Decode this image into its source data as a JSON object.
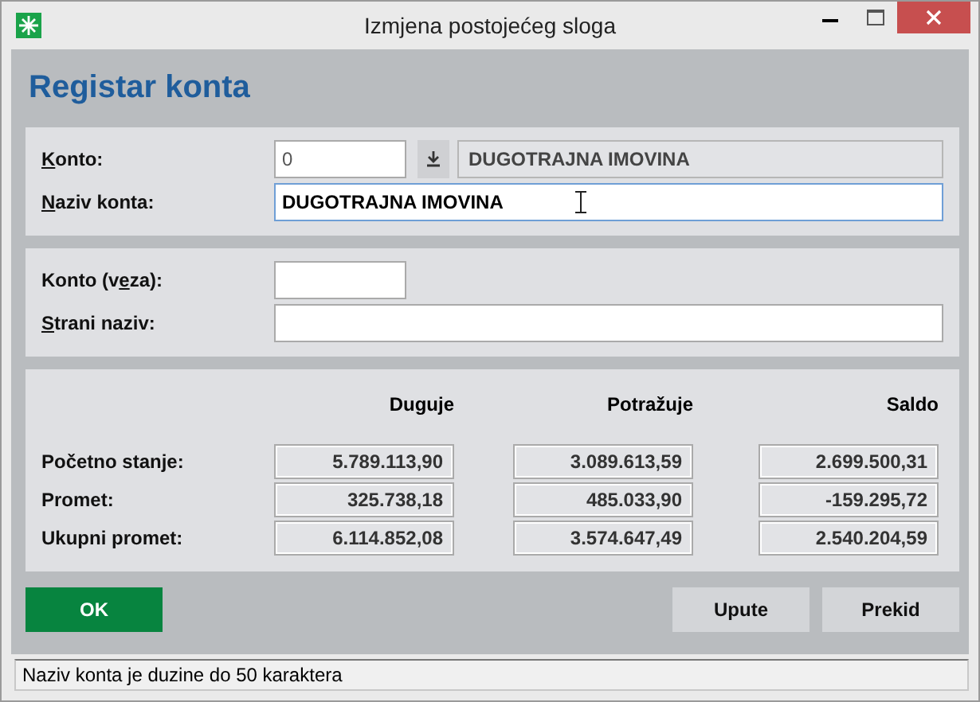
{
  "window": {
    "title": "Izmjena postojećeg sloga"
  },
  "heading": "Registar konta",
  "panel_main": {
    "konto": {
      "label": {
        "key": "K",
        "post": "onto:"
      },
      "value": "0",
      "description": "DUGOTRAJNA IMOVINA"
    },
    "naziv": {
      "label": {
        "key": "N",
        "post": "aziv konta:"
      },
      "value": "DUGOTRAJNA IMOVINA",
      "focused": true
    }
  },
  "panel_extra": [
    {
      "kind": "short",
      "label": {
        "pre": "Konto (v",
        "key": "e",
        "post": "za):"
      }
    },
    {
      "kind": "wide",
      "label": {
        "key": "S",
        "post": "trani naziv:"
      }
    }
  ],
  "totals": {
    "columns": [
      "Duguje",
      "Potražuje",
      "Saldo"
    ],
    "rows": [
      {
        "label": "Početno stanje:",
        "values": [
          "5.789.113,90",
          "3.089.613,59",
          "2.699.500,31"
        ]
      },
      {
        "label": "Promet:",
        "values": [
          "325.738,18",
          "485.033,90",
          "-159.295,72"
        ]
      },
      {
        "label": "Ukupni promet:",
        "values": [
          "6.114.852,08",
          "3.574.647,49",
          "2.540.204,59"
        ]
      }
    ]
  },
  "buttons": [
    {
      "label": "OK",
      "kind": "primary"
    },
    {
      "label": "Upute",
      "kind": "normal"
    },
    {
      "label": "Prekid",
      "kind": "normal"
    }
  ],
  "status_bar": "Naziv konta je duzine do 50 karaktera"
}
